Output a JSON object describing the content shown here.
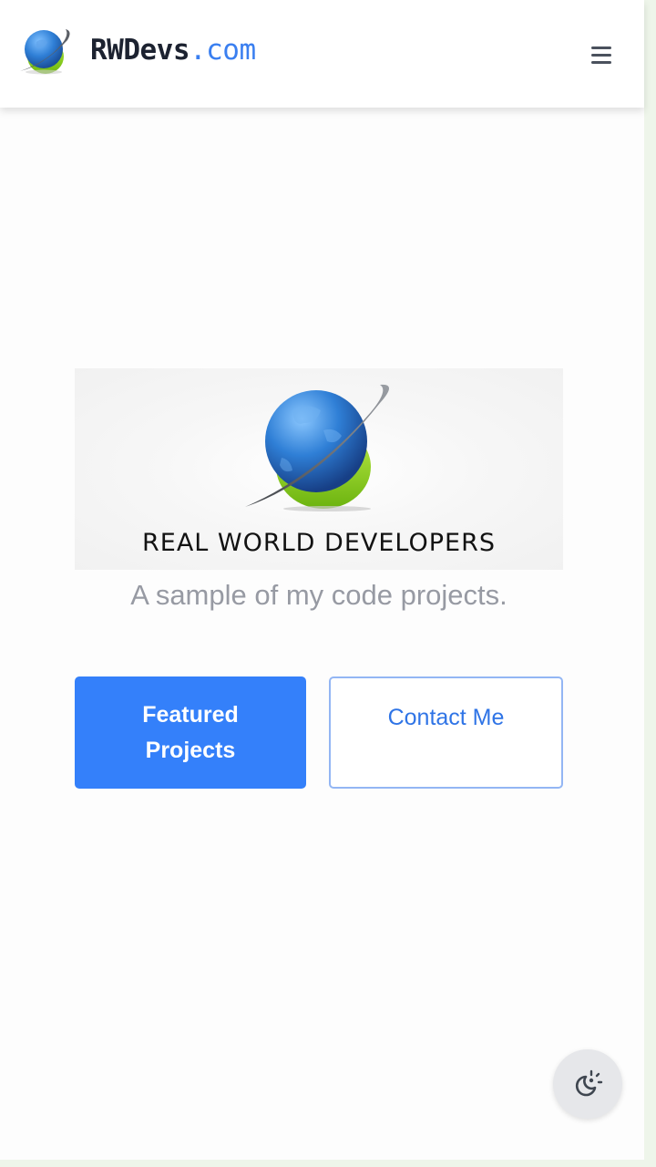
{
  "header": {
    "brand_name": "RWDevs",
    "brand_tld": ".com",
    "logo_icon": "globe-logo-icon",
    "menu_icon": "hamburger-menu-icon"
  },
  "hero": {
    "logo_text": "REAL WORLD DEVELOPERS",
    "tagline": "A sample of my code projects."
  },
  "actions": {
    "primary_label": "Featured Projects",
    "secondary_label": "Contact Me"
  },
  "theme_toggle": {
    "icon": "theme-toggle-icon"
  },
  "colors": {
    "accent": "#3480fa",
    "accent_text": "#2f74e6",
    "brand_dark": "#1c2230",
    "muted_text": "#979aa3",
    "globe_blue": "#2f7fd6",
    "globe_green": "#8ccf1e"
  }
}
